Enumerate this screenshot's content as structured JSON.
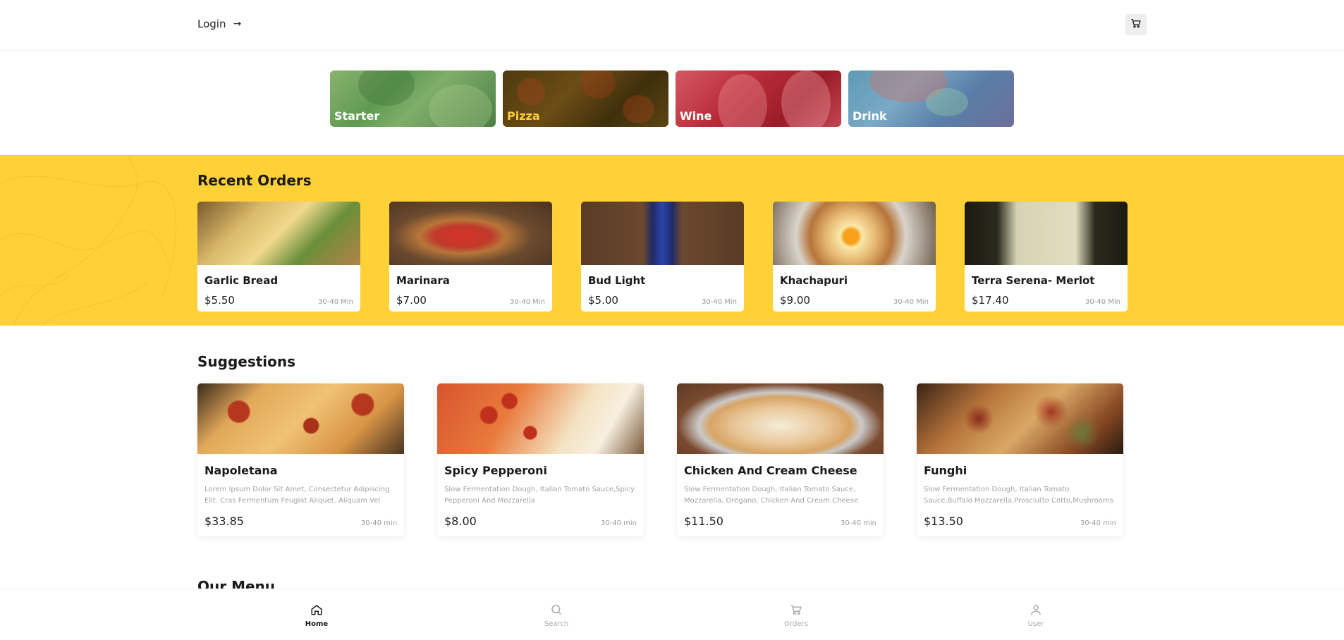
{
  "header": {
    "login_label": "Login",
    "login_arrow": "→",
    "cart_icon": "cart-icon"
  },
  "categories": [
    {
      "label": "Starter",
      "active": false
    },
    {
      "label": "Pizza",
      "active": true
    },
    {
      "label": "Wine",
      "active": false
    },
    {
      "label": "Drink",
      "active": false
    }
  ],
  "recent": {
    "title": "Recent Orders",
    "items": [
      {
        "name": "Garlic Bread",
        "price": "$5.50",
        "time": "30-40 Min"
      },
      {
        "name": "Marinara",
        "price": "$7.00",
        "time": "30-40 Min"
      },
      {
        "name": "Bud Light",
        "price": "$5.00",
        "time": "30-40 Min"
      },
      {
        "name": "Khachapuri",
        "price": "$9.00",
        "time": "30-40 Min"
      },
      {
        "name": "Terra Serena- Merlot",
        "price": "$17.40",
        "time": "30-40 Min"
      }
    ]
  },
  "suggestions": {
    "title": "Suggestions",
    "items": [
      {
        "name": "Napoletana",
        "desc": "Lorem Ipsum Dolor Sit Amet, Consectetur Adipiscing Elit. Cras Fermentum Feugiat Aliquet. Aliquam Vel",
        "price": "$33.85",
        "time": "30-40 min"
      },
      {
        "name": "Spicy Pepperoni",
        "desc": "Slow Fermentation Dough, Italian Tomato Sauce,Spicy Pepperoni And Mozzarella",
        "price": "$8.00",
        "time": "30-40 min"
      },
      {
        "name": "Chicken And Cream Cheese",
        "desc": "Slow Fermentation Dough, Italian Tomato Sauce, Mozzarella, Oregano, Chicken And Cream Cheese.",
        "price": "$11.50",
        "time": "30-40 min"
      },
      {
        "name": "Funghi",
        "desc": "Slow Fermentation Dough, Italian Tomato Sauce,Buffalo Mozzarella,Prosciutto Cotto,Mushrooms",
        "price": "$13.50",
        "time": "30-40 min"
      }
    ]
  },
  "menu": {
    "title": "Our Menu"
  },
  "nav": {
    "items": [
      {
        "label": "Home",
        "icon": "home-icon",
        "active": true
      },
      {
        "label": "Search",
        "icon": "search-icon",
        "active": false
      },
      {
        "label": "Orders",
        "icon": "cart-icon",
        "active": false
      },
      {
        "label": "User",
        "icon": "user-icon",
        "active": false
      }
    ]
  },
  "colors": {
    "accent": "#fed136",
    "active_category": "#ffcf3a"
  }
}
